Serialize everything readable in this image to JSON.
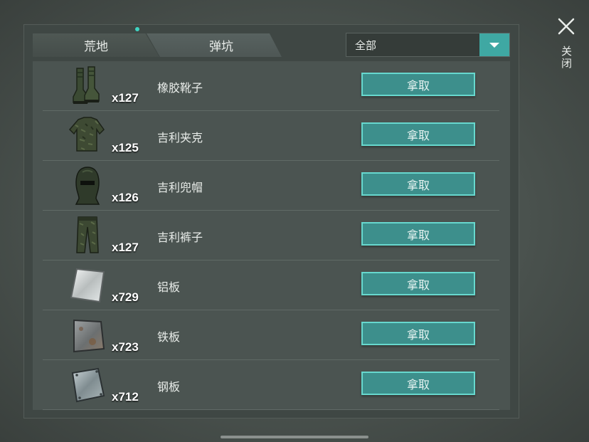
{
  "tabs": [
    {
      "label": "荒地"
    },
    {
      "label": "弹坑"
    }
  ],
  "filter": {
    "selected": "全部"
  },
  "close_label": "关闭",
  "take_label": "拿取",
  "items": [
    {
      "name": "橡胶靴子",
      "count": "x127",
      "icon": "rubber-boots-icon"
    },
    {
      "name": "吉利夹克",
      "count": "x125",
      "icon": "ghillie-jacket-icon"
    },
    {
      "name": "吉利兜帽",
      "count": "x126",
      "icon": "ghillie-hood-icon"
    },
    {
      "name": "吉利裤子",
      "count": "x127",
      "icon": "ghillie-pants-icon"
    },
    {
      "name": "铝板",
      "count": "x729",
      "icon": "aluminum-plate-icon"
    },
    {
      "name": "铁板",
      "count": "x723",
      "icon": "iron-plate-icon"
    },
    {
      "name": "钢板",
      "count": "x712",
      "icon": "steel-plate-icon"
    }
  ],
  "colors": {
    "accent": "#3fa8a3",
    "button_border": "#67d8ce",
    "tab_dot": "#3fd3c2"
  }
}
